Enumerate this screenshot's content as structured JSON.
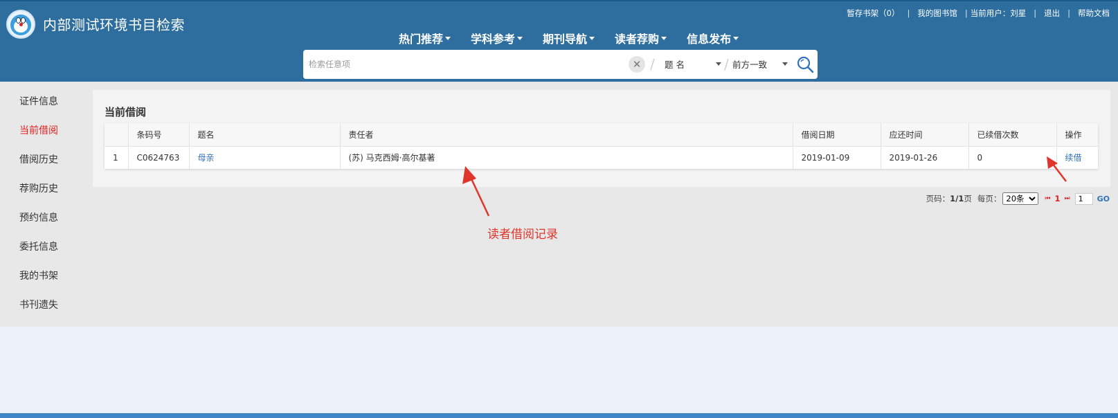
{
  "header": {
    "site_title": "内部测试环境书目检索",
    "top_links": {
      "shelf": "暂存书架（0）",
      "my_library": "我的图书馆",
      "current_user_label": "当前用户：",
      "current_user_name": "刘星",
      "logout": "退出",
      "help": "帮助文档"
    },
    "nav": [
      {
        "label": "热门推荐"
      },
      {
        "label": "学科参考"
      },
      {
        "label": "期刊导航"
      },
      {
        "label": "读者荐购"
      },
      {
        "label": "信息发布"
      }
    ]
  },
  "search": {
    "placeholder": "检索任意项",
    "field_selected": "题 名",
    "match_selected": "前方一致"
  },
  "sidebar": {
    "items": [
      {
        "label": "证件信息"
      },
      {
        "label": "当前借阅",
        "active": true
      },
      {
        "label": "借阅历史"
      },
      {
        "label": "荐购历史"
      },
      {
        "label": "预约信息"
      },
      {
        "label": "委托信息"
      },
      {
        "label": "我的书架"
      },
      {
        "label": "书刊遗失"
      }
    ]
  },
  "main": {
    "section_title": "当前借阅",
    "table": {
      "headers": [
        "",
        "条码号",
        "题名",
        "责任者",
        "借阅日期",
        "应还时间",
        "已续借次数",
        "操作"
      ],
      "rows": [
        {
          "index": "1",
          "barcode": "C0624763",
          "title": "母亲",
          "author": "(苏) 马克西姆·高尔基著",
          "borrow_date": "2019-01-09",
          "due_date": "2019-01-26",
          "renew_count": "0",
          "action": "续借"
        }
      ]
    },
    "pager": {
      "page_label": "页码：",
      "page_value": "1/1",
      "page_suffix": "页",
      "per_page_label": "每页：",
      "per_page_selected": "20条",
      "current_page": "1",
      "page_input": "1",
      "go": "GO"
    }
  },
  "annotation": {
    "text": "读者借阅记录",
    "color": "#e0352b"
  },
  "colors": {
    "header_bg": "#2d6e9f",
    "active_sidebar": "#e02020",
    "link": "#3172b7"
  }
}
